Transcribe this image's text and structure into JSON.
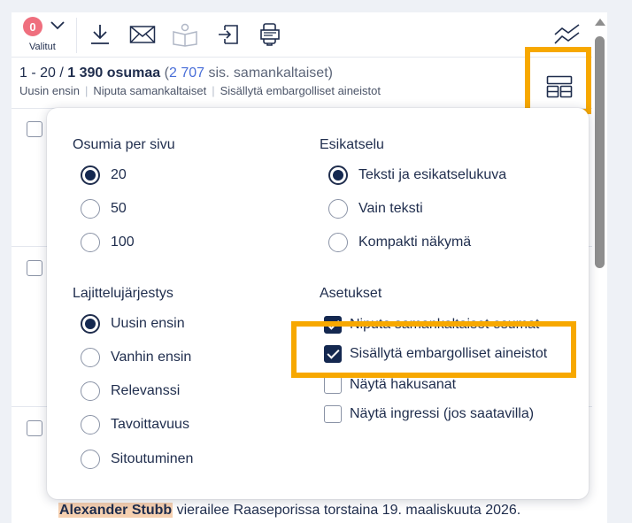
{
  "toolbar": {
    "selected_count": "0",
    "selected_label": "Valitut",
    "actions": [
      "download-icon",
      "mail-icon",
      "open-book-icon",
      "export-icon",
      "devices-icon",
      "trend-icon"
    ]
  },
  "summary": {
    "range": "1 - 20 / ",
    "count": "1 390 osumaa",
    "similar_open": " (",
    "similar_num": "2 707",
    "similar_text": " sis. samankaltaiset)",
    "sort_items": [
      "Uusin ensin",
      "Niputa samankaltaiset",
      "Sisällytä embargolliset aineistot"
    ],
    "separator": "|"
  },
  "settings": {
    "per_page": {
      "title": "Osumia per sivu",
      "options": [
        "20",
        "50",
        "100"
      ],
      "selected": "20"
    },
    "preview": {
      "title": "Esikatselu",
      "options": [
        "Teksti ja esikatselukuva",
        "Vain teksti",
        "Kompakti näkymä"
      ],
      "selected": "Teksti ja esikatselukuva"
    },
    "sorting": {
      "title": "Lajittelujärjestys",
      "options": [
        "Uusin ensin",
        "Vanhin ensin",
        "Relevanssi",
        "Tavoittavuus",
        "Sitoutuminen"
      ],
      "selected": "Uusin ensin"
    },
    "options": {
      "title": "Asetukset",
      "checkboxes": [
        {
          "label": "Niputa samankaltaiset osumat",
          "checked": true
        },
        {
          "label": "Sisällytä embargolliset aineistot",
          "checked": true
        },
        {
          "label": "Näytä hakusanat",
          "checked": false
        },
        {
          "label": "Näytä ingressi (jos saatavilla)",
          "checked": false
        }
      ]
    }
  },
  "snippet": {
    "highlight": "Alexander Stubb",
    "text": " vierailee Raaseporissa torstaina 19. maaliskuuta 2026."
  },
  "colors": {
    "accent_dark": "#142850",
    "highlight_box": "#f7a800",
    "badge": "#ef6f7e",
    "link": "#4a6fd8"
  }
}
